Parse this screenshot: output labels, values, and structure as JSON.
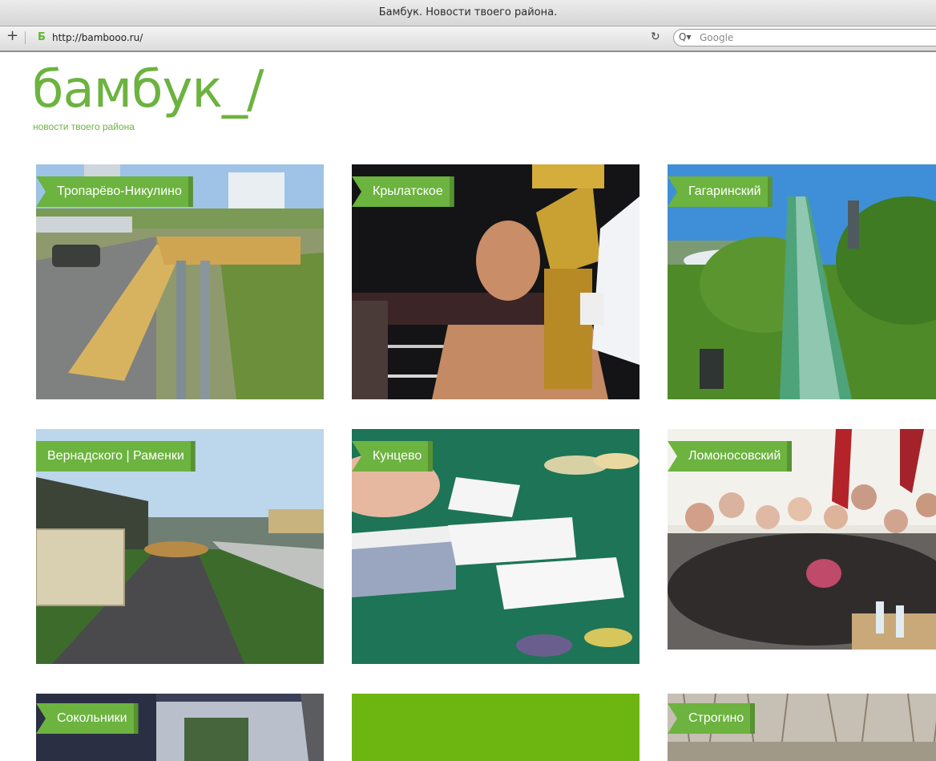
{
  "browser": {
    "window_title": "Бамбук. Новости твоего района.",
    "new_tab_symbol": "+",
    "favicon_letter": "Б",
    "url": "http://bambooo.ru/",
    "reload_symbol": "↻",
    "search_icon": "Q▾",
    "search_placeholder": "Google"
  },
  "logo": {
    "wordmark": "бамбук_/",
    "tagline": "новости твоего района",
    "color": "#6cb33f"
  },
  "tiles": [
    {
      "label": "Тропарёво-Никулино",
      "image": "wooden-ramp-and-pipes"
    },
    {
      "label": "Крылатское",
      "image": "boxer-with-trophy"
    },
    {
      "label": "Гагаринский",
      "image": "ski-jump-hill"
    },
    {
      "label": "Вернадского | Раменки",
      "image": "wet-path-with-concrete-blocks"
    },
    {
      "label": "Кунцево",
      "image": "casino-cards-and-chips"
    },
    {
      "label": "Ломоносовский",
      "image": "group-of-people-in-office"
    },
    {
      "label": "Сокольники",
      "image": "projection-screen"
    },
    {
      "label": "",
      "image": "plain-green-tile"
    },
    {
      "label": "Строгино",
      "image": "bare-trees"
    }
  ],
  "colors": {
    "accent": "#6cb33f",
    "plain_tile": "#6db611"
  }
}
